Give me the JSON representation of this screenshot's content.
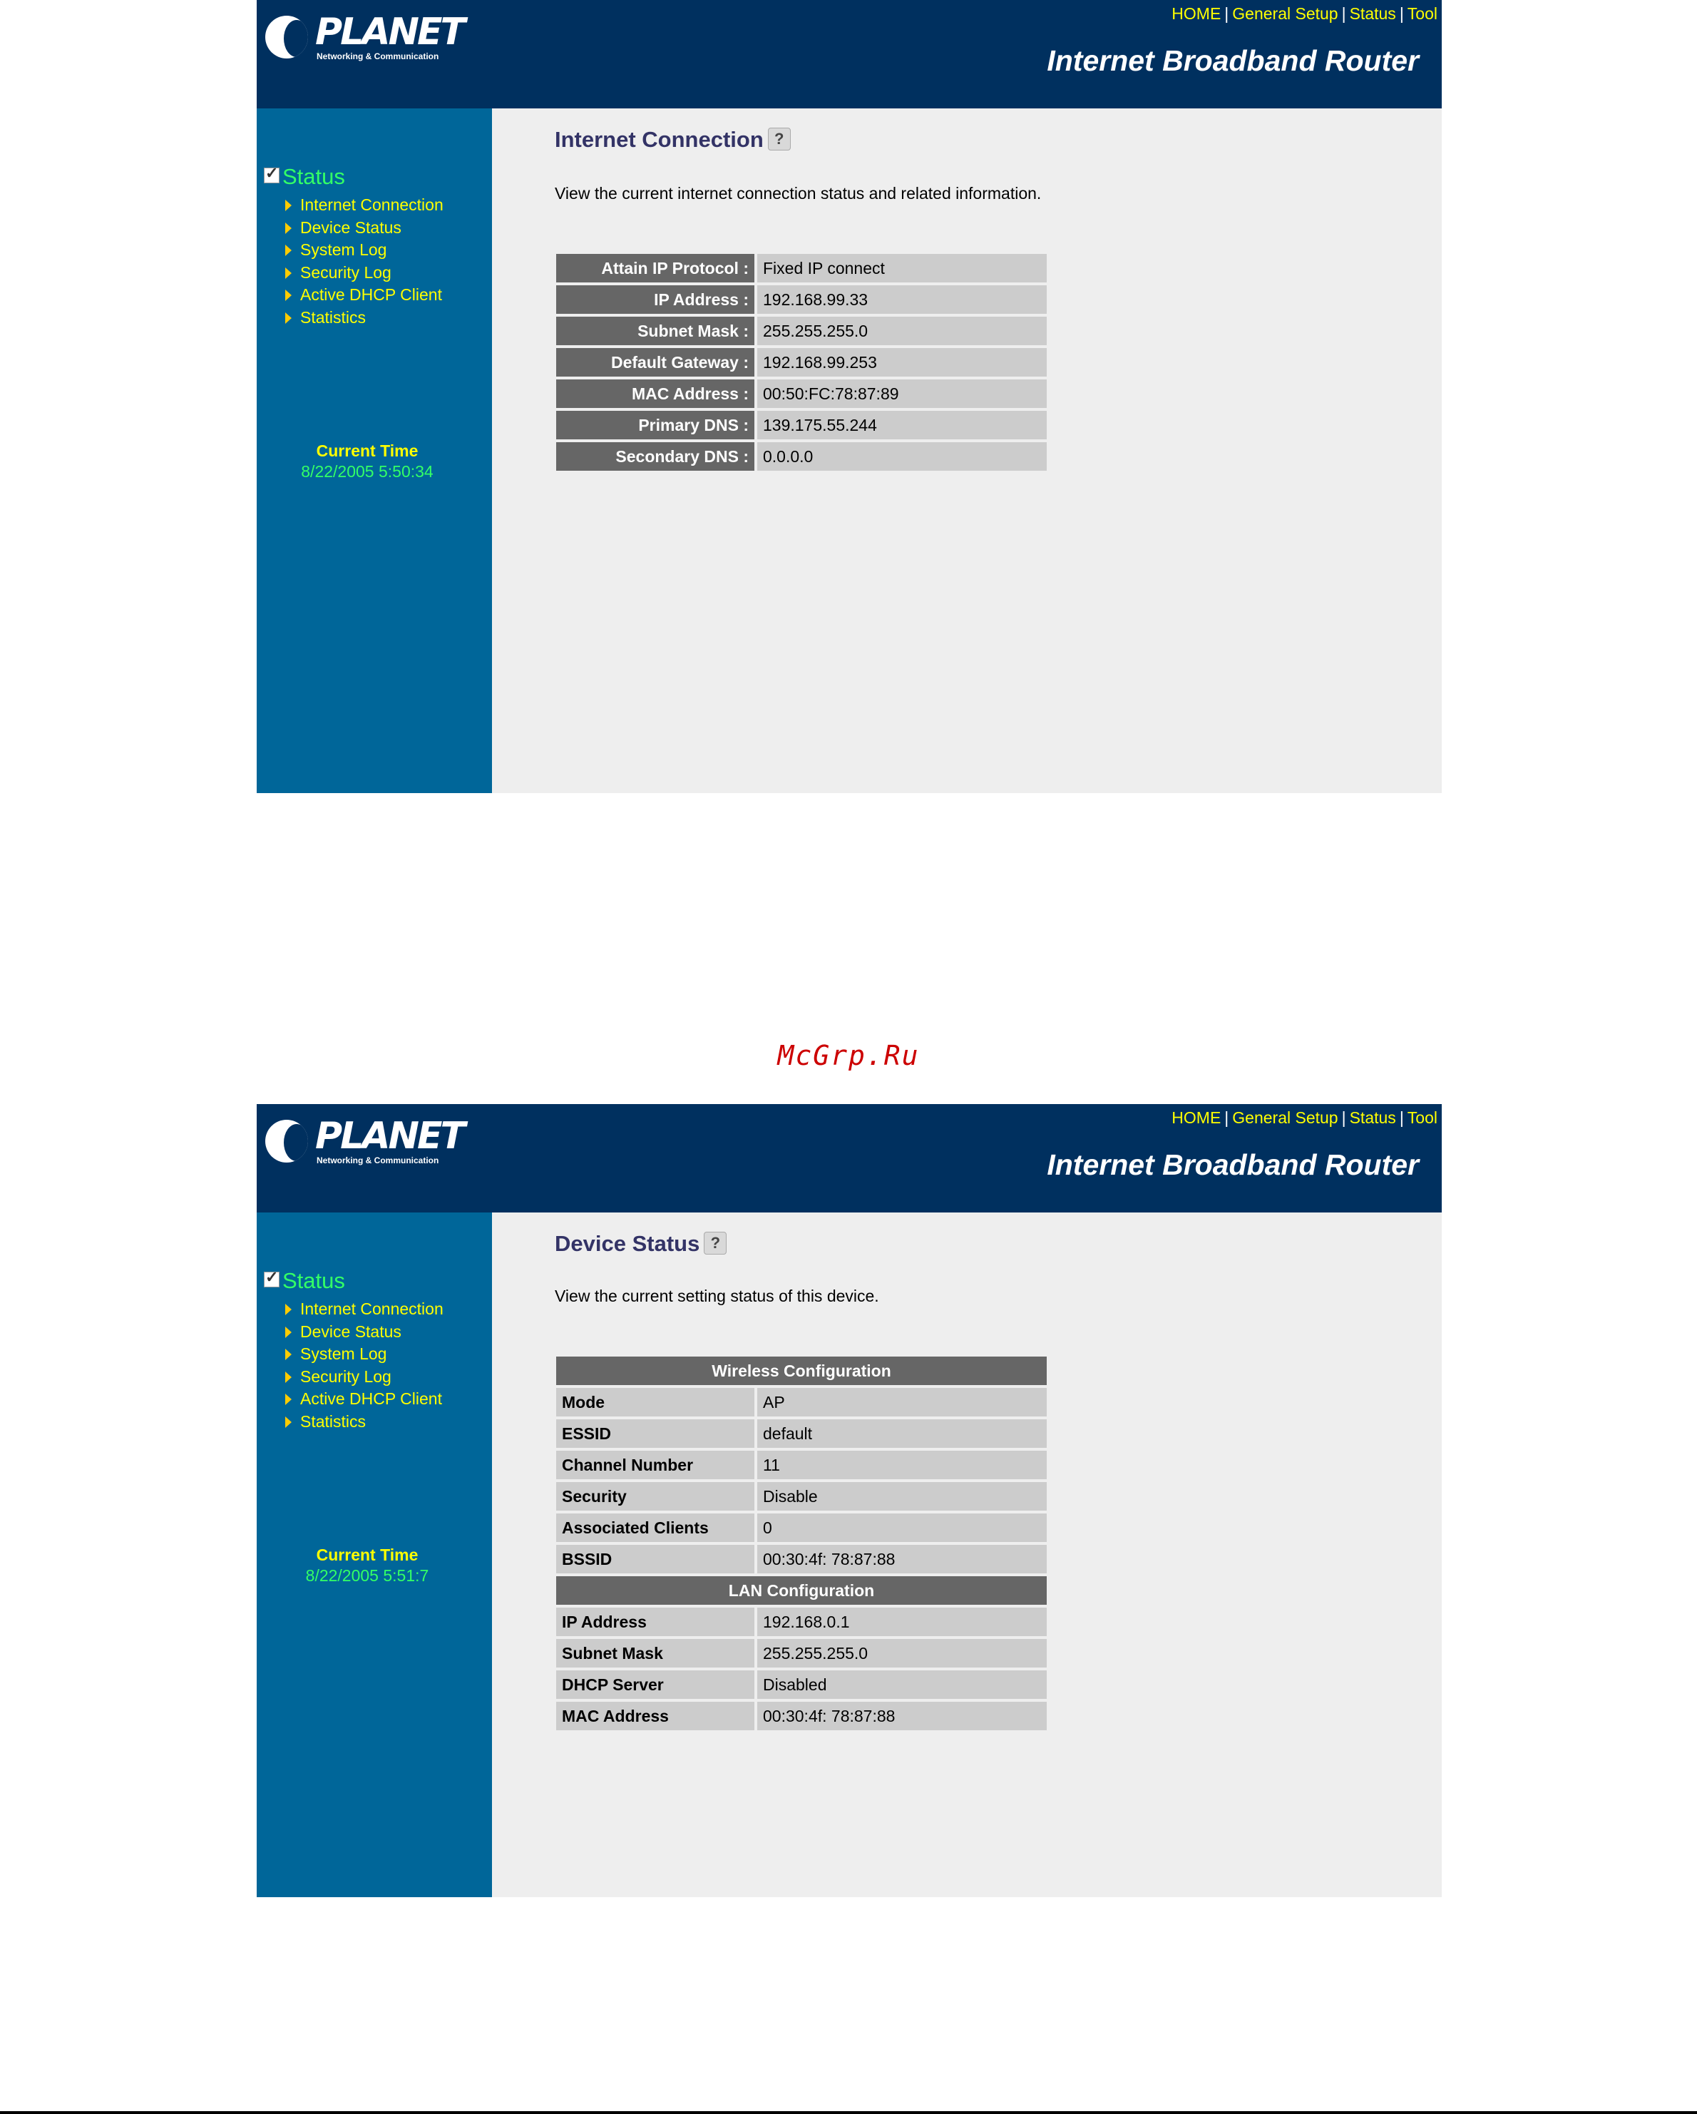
{
  "common": {
    "logo_word": "PLANET",
    "logo_sub": "Networking & Communication",
    "router_title": "Internet Broadband Router",
    "nav": [
      "HOME",
      "General Setup",
      "Status",
      "Tool"
    ],
    "sidebar_heading": "Status",
    "sidebar_items": [
      "Internet Connection",
      "Device Status",
      "System Log",
      "Security Log",
      "Active DHCP Client",
      "Statistics"
    ],
    "current_time_label": "Current Time",
    "help_icon": "help-icon"
  },
  "screen1": {
    "current_time": "8/22/2005 5:50:34",
    "title": "Internet Connection",
    "description": "View the current internet connection status and related information.",
    "rows": [
      {
        "label": "Attain IP Protocol :",
        "value": "Fixed IP connect"
      },
      {
        "label": "IP Address :",
        "value": "192.168.99.33"
      },
      {
        "label": "Subnet Mask :",
        "value": "255.255.255.0"
      },
      {
        "label": "Default Gateway :",
        "value": "192.168.99.253"
      },
      {
        "label": "MAC Address :",
        "value": "00:50:FC:78:87:89"
      },
      {
        "label": "Primary DNS :",
        "value": "139.175.55.244"
      },
      {
        "label": "Secondary DNS :",
        "value": "0.0.0.0"
      }
    ]
  },
  "screen2": {
    "current_time": "8/22/2005 5:51:7",
    "title": "Device Status",
    "description": "View the current setting status of this device.",
    "wireless_heading": "Wireless Configuration",
    "wireless_rows": [
      {
        "label": "Mode",
        "value": " AP"
      },
      {
        "label": "ESSID",
        "value": "default"
      },
      {
        "label": "Channel Number",
        "value": "11"
      },
      {
        "label": "Security",
        "value": " Disable"
      },
      {
        "label": "Associated Clients",
        "value": "0"
      },
      {
        "label": "BSSID",
        "value": "00:30:4f: 78:87:88"
      }
    ],
    "lan_heading": "LAN Configuration",
    "lan_rows": [
      {
        "label": "IP Address",
        "value": "192.168.0.1"
      },
      {
        "label": "Subnet Mask",
        "value": "255.255.255.0"
      },
      {
        "label": "DHCP Server",
        "value": "Disabled"
      },
      {
        "label": "MAC Address",
        "value": "00:30:4f: 78:87:88"
      }
    ]
  },
  "watermark": "McGrp.Ru",
  "colors": {
    "header_bg": "#00305f",
    "sidebar_bg": "#006699",
    "content_bg": "#eeeeee",
    "nav_link": "#ffff00",
    "sidebar_heading": "#33ff66",
    "label_cell": "#666666",
    "value_cell": "#cccccc",
    "watermark": "#cc0000"
  }
}
